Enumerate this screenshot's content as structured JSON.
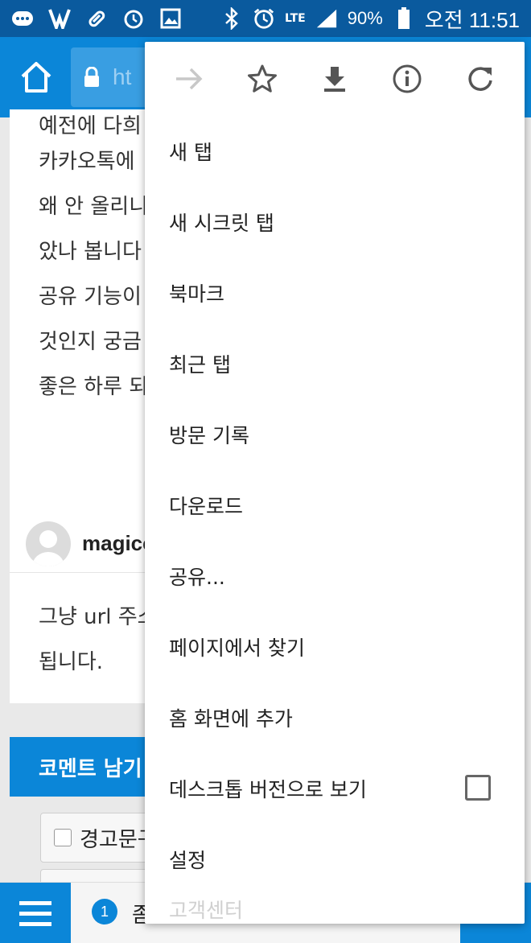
{
  "status_bar": {
    "battery": "90%",
    "network": "LTE",
    "time": "오전 11:51"
  },
  "toolbar": {
    "url_fragment": "ht"
  },
  "page": {
    "lines": [
      "예전에 다희",
      "카카오톡에",
      "왜 안 올리니",
      "았나 봅니다",
      "공유 기능이",
      "것인지 궁금",
      "좋은 하루 되"
    ],
    "comment": {
      "username": "magicc",
      "lines": [
        "그냥 url 주소",
        "됩니다."
      ]
    },
    "comment_section_title": "코멘트 남기",
    "checkbox_label": "경고문구",
    "bottom": {
      "count": "1",
      "text": "좀"
    }
  },
  "menu": {
    "icons": [
      "forward-icon",
      "star-icon",
      "download-icon",
      "info-icon",
      "refresh-icon"
    ],
    "items": [
      "새 탭",
      "새 시크릿 탭",
      "북마크",
      "최근 탭",
      "방문 기록",
      "다운로드",
      "공유...",
      "페이지에서 찾기",
      "홈 화면에 추가",
      "데스크톱 버전으로 보기",
      "설정",
      "고객센터"
    ],
    "desktop_checked": false
  },
  "colors": {
    "statusbar": "#0a5a9e",
    "toolbar": "#0b86d8",
    "menu_bg": "#ffffff"
  }
}
